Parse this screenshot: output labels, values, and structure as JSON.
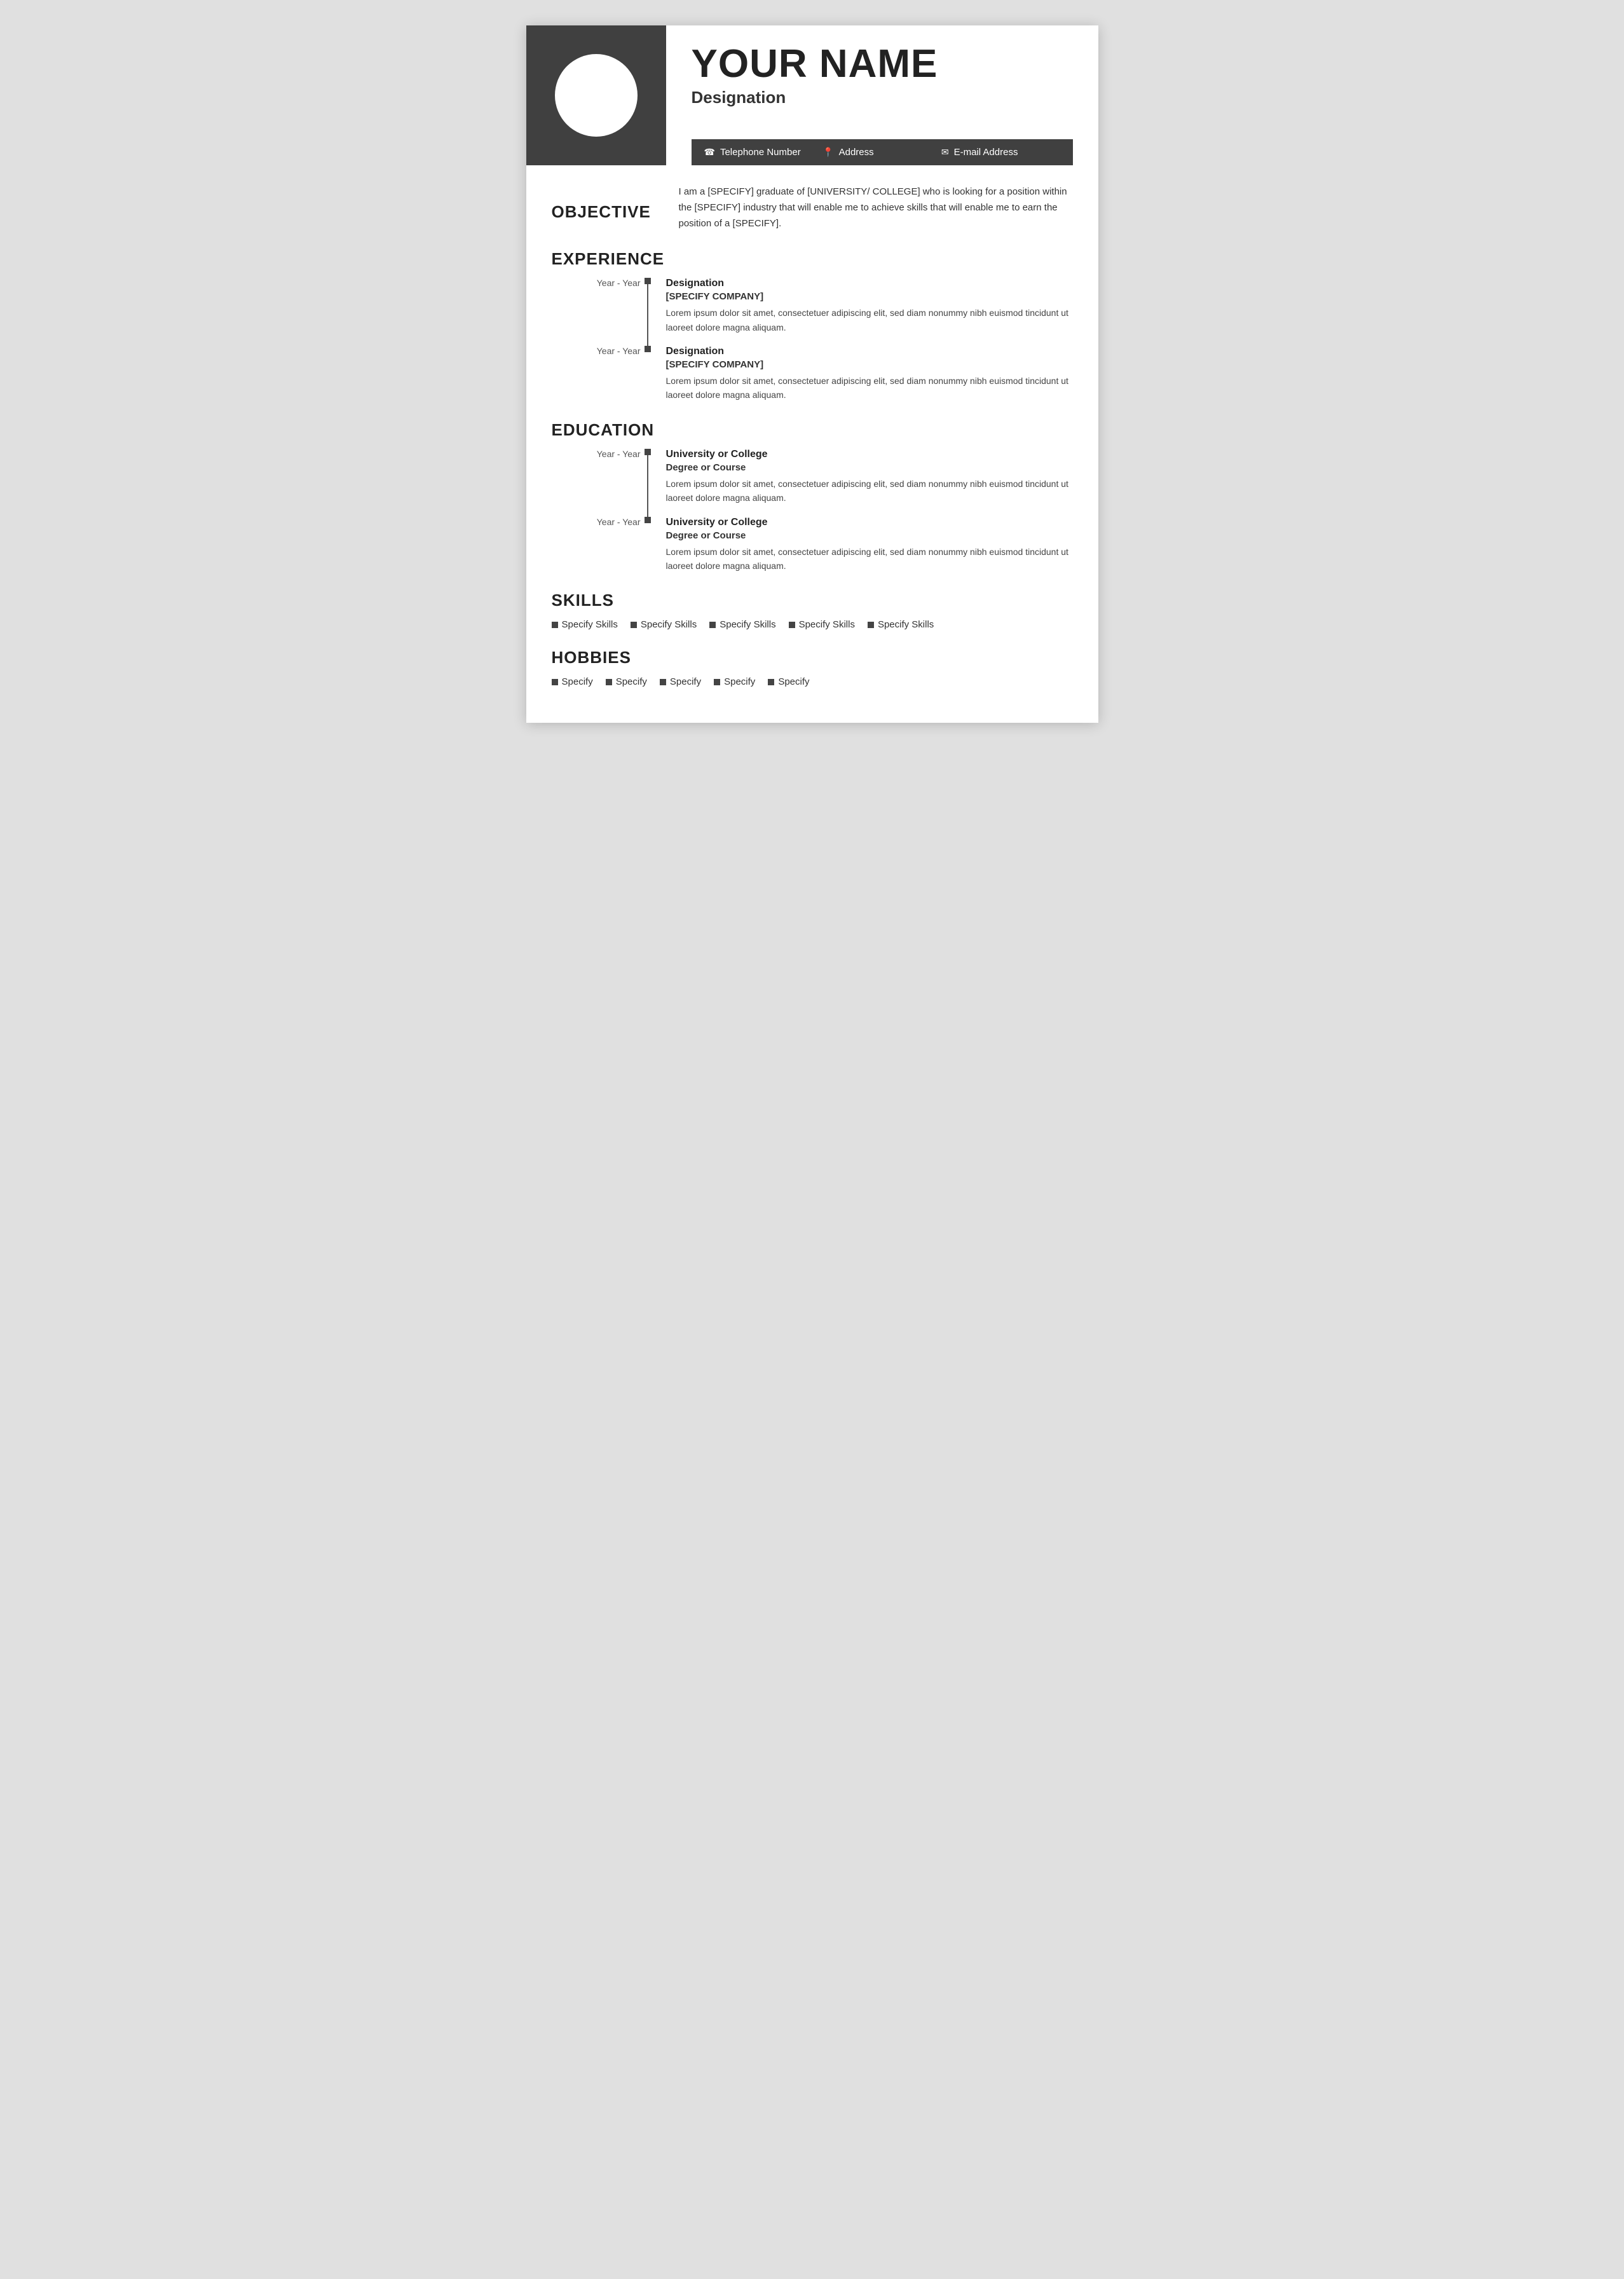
{
  "header": {
    "name": "YOUR NAME",
    "designation": "Designation",
    "contact": {
      "phone": "Telephone Number",
      "address": "Address",
      "email": "E-mail Address"
    }
  },
  "objective": {
    "section_title": "OBJECTIVE",
    "text": "I am a [SPECIFY] graduate of [UNIVERSITY/ COLLEGE] who is looking for a position within the [SPECIFY] industry that will enable me to achieve skills that will enable me to earn the position of a [SPECIFY]."
  },
  "experience": {
    "section_title": "EXPERIENCE",
    "entries": [
      {
        "years": "Year - Year",
        "job_title": "Designation",
        "company": "[SPECIFY COMPANY]",
        "description": "Lorem ipsum dolor sit amet, consectetuer adipiscing elit, sed diam nonummy nibh euismod tincidunt ut laoreet dolore magna aliquam."
      },
      {
        "years": "Year - Year",
        "job_title": "Designation",
        "company": "[SPECIFY COMPANY]",
        "description": "Lorem ipsum dolor sit amet, consectetuer adipiscing elit, sed diam nonummy nibh euismod tincidunt ut laoreet dolore magna aliquam."
      }
    ]
  },
  "education": {
    "section_title": "EDUCATION",
    "entries": [
      {
        "years": "Year - Year",
        "institution": "University or College",
        "degree": "Degree or Course",
        "description": "Lorem ipsum dolor sit amet, consectetuer adipiscing elit, sed diam nonummy nibh euismod tincidunt ut laoreet dolore magna aliquam."
      },
      {
        "years": "Year - Year",
        "institution": "University or College",
        "degree": "Degree or Course",
        "description": "Lorem ipsum dolor sit amet, consectetuer adipiscing elit, sed diam nonummy nibh euismod tincidunt ut laoreet dolore magna aliquam."
      }
    ]
  },
  "skills": {
    "section_title": "SKILLS",
    "items": [
      "Specify Skills",
      "Specify Skills",
      "Specify Skills",
      "Specify Skills",
      "Specify Skills"
    ]
  },
  "hobbies": {
    "section_title": "HOBBIES",
    "items": [
      "Specify",
      "Specify",
      "Specify",
      "Specify",
      "Specify"
    ]
  }
}
